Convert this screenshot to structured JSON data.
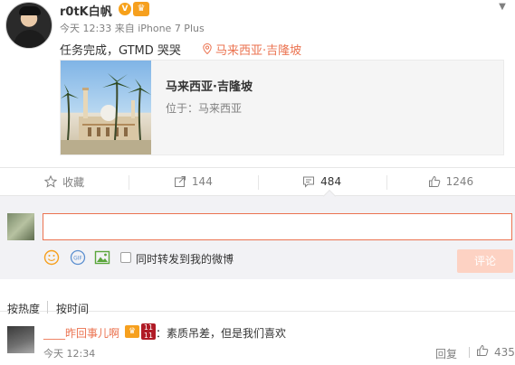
{
  "post": {
    "author": "r0tK白帆",
    "verified_mark": "V",
    "meta": "今天 12:33 来自 iPhone 7 Plus",
    "text": "任务完成，GTMD 哭哭",
    "location": "马来西亚·吉隆坡",
    "menu_icon": "chevron-down-icon"
  },
  "location_card": {
    "title": "马来西亚·吉隆坡",
    "subtitle": "位于：马来西亚"
  },
  "actions": [
    {
      "name": "favorite",
      "label": "收藏",
      "icon": "star-icon"
    },
    {
      "name": "repost",
      "label": "144",
      "icon": "share-icon"
    },
    {
      "name": "comment",
      "label": "484",
      "icon": "comment-icon"
    },
    {
      "name": "like",
      "label": "1246",
      "icon": "thumbs-up-icon"
    }
  ],
  "composer": {
    "input_value": "",
    "repost_label": "同时转发到我的微博",
    "submit_label": "评论"
  },
  "sort": {
    "hot": "按热度",
    "time": "按时间"
  },
  "comments": [
    {
      "author": "____昨回事儿啊",
      "text": "：素质吊差，但是我们喜欢",
      "time": "今天 12:34",
      "reply_label": "回复",
      "likes": "435"
    }
  ],
  "colors": {
    "accent": "#eb7350",
    "muted": "#808080",
    "panel": "#f2f2f5",
    "submit_disabled": "#fdd2c3"
  }
}
